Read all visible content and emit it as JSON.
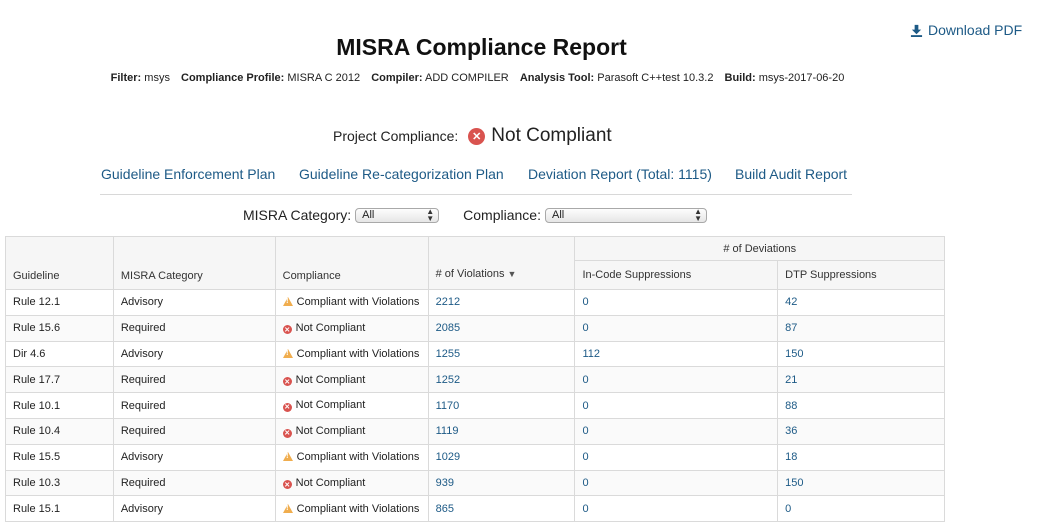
{
  "download_label": "Download PDF",
  "title": "MISRA Compliance Report",
  "filter_bar": {
    "filter_label": "Filter:",
    "filter_value": "msys",
    "profile_label": "Compliance Profile:",
    "profile_value": "MISRA C 2012",
    "compiler_label": "Compiler:",
    "compiler_value": "ADD COMPILER",
    "tool_label": "Analysis Tool:",
    "tool_value": "Parasoft C++test 10.3.2",
    "build_label": "Build:",
    "build_value": "msys-2017-06-20"
  },
  "project": {
    "label": "Project Compliance:",
    "status": "Not Compliant",
    "status_color": "#d9534f"
  },
  "links": [
    "Guideline Enforcement Plan",
    "Guideline Re-categorization Plan",
    "Deviation Report (Total: 1115)",
    "Build Audit Report"
  ],
  "filters": {
    "category_label": "MISRA Category:",
    "category_value": "All",
    "compliance_label": "Compliance:",
    "compliance_value": "All"
  },
  "table": {
    "deviations_group": "# of Deviations",
    "columns": [
      "Guideline",
      "MISRA Category",
      "Compliance",
      "# of Violations",
      "In-Code Suppressions",
      "DTP Suppressions"
    ],
    "rows": [
      {
        "guideline": "Rule 12.1",
        "category": "Advisory",
        "compliance": "Compliant with Violations",
        "status": "warn",
        "violations": "2212",
        "incode": "0",
        "dtp": "42"
      },
      {
        "guideline": "Rule 15.6",
        "category": "Required",
        "compliance": "Not Compliant",
        "status": "error",
        "violations": "2085",
        "incode": "0",
        "dtp": "87"
      },
      {
        "guideline": "Dir 4.6",
        "category": "Advisory",
        "compliance": "Compliant with Violations",
        "status": "warn",
        "violations": "1255",
        "incode": "112",
        "dtp": "150"
      },
      {
        "guideline": "Rule 17.7",
        "category": "Required",
        "compliance": "Not Compliant",
        "status": "error",
        "violations": "1252",
        "incode": "0",
        "dtp": "21"
      },
      {
        "guideline": "Rule 10.1",
        "category": "Required",
        "compliance": "Not Compliant",
        "status": "error",
        "violations": "1170",
        "incode": "0",
        "dtp": "88"
      },
      {
        "guideline": "Rule 10.4",
        "category": "Required",
        "compliance": "Not Compliant",
        "status": "error",
        "violations": "1119",
        "incode": "0",
        "dtp": "36"
      },
      {
        "guideline": "Rule 15.5",
        "category": "Advisory",
        "compliance": "Compliant with Violations",
        "status": "warn",
        "violations": "1029",
        "incode": "0",
        "dtp": "18"
      },
      {
        "guideline": "Rule 10.3",
        "category": "Required",
        "compliance": "Not Compliant",
        "status": "error",
        "violations": "939",
        "incode": "0",
        "dtp": "150"
      },
      {
        "guideline": "Rule 15.1",
        "category": "Advisory",
        "compliance": "Compliant with Violations",
        "status": "warn",
        "violations": "865",
        "incode": "0",
        "dtp": "0"
      }
    ]
  }
}
